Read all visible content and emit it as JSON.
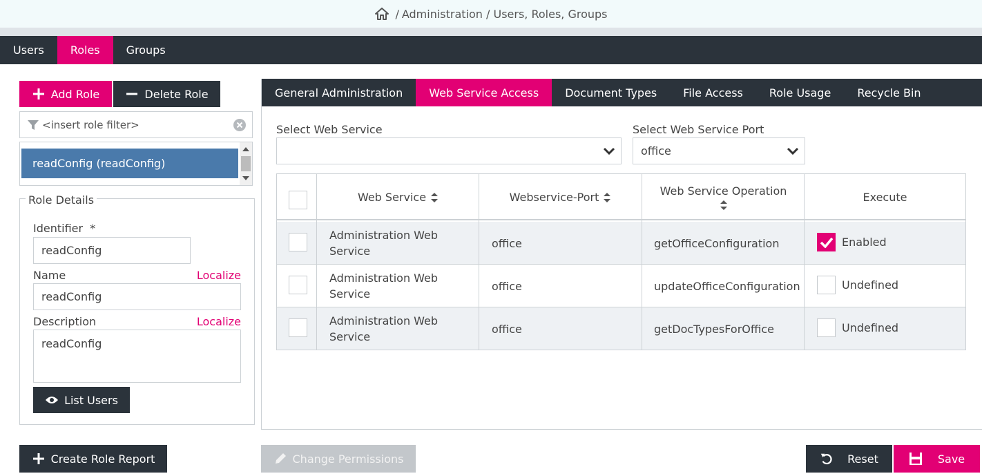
{
  "breadcrumb": {
    "path": "Administration / Users, Roles, Groups"
  },
  "main_tabs": [
    {
      "label": "Users"
    },
    {
      "label": "Roles"
    },
    {
      "label": "Groups"
    }
  ],
  "role_buttons": {
    "add": "Add Role",
    "delete": "Delete Role"
  },
  "role_filter": {
    "placeholder": "<insert role filter>"
  },
  "role_list": [
    {
      "label": "readConfig (readConfig)"
    }
  ],
  "role_details": {
    "legend": "Role Details",
    "identifier_label": "Identifier",
    "required_mark": "*",
    "identifier_value": "readConfig",
    "name_label": "Name",
    "name_value": "readConfig",
    "description_label": "Description",
    "description_value": "readConfig",
    "localize": "Localize",
    "list_users": "List Users"
  },
  "sub_tabs": [
    {
      "label": "General Administration"
    },
    {
      "label": "Web Service Access"
    },
    {
      "label": "Document Types"
    },
    {
      "label": "File Access"
    },
    {
      "label": "Role Usage"
    },
    {
      "label": "Recycle Bin"
    }
  ],
  "web_service": {
    "select_label": "Select Web Service",
    "select_value": "",
    "port_label": "Select Web Service Port",
    "port_value": "office"
  },
  "table": {
    "headers": {
      "service": "Web Service",
      "port": "Webservice-Port",
      "operation": "Web Service Operation",
      "execute": "Execute"
    },
    "rows": [
      {
        "service": "Administration Web Service",
        "port": "office",
        "operation": "getOfficeConfiguration",
        "execute": "Enabled",
        "checked": true
      },
      {
        "service": "Administration Web Service",
        "port": "office",
        "operation": "updateOfficeConfiguration",
        "execute": "Undefined",
        "checked": false
      },
      {
        "service": "Administration Web Service",
        "port": "office",
        "operation": "getDocTypesForOffice",
        "execute": "Undefined",
        "checked": false
      }
    ]
  },
  "footer": {
    "create_report": "Create Role Report",
    "change_permissions": "Change Permissions",
    "reset": "Reset",
    "save": "Save"
  },
  "colors": {
    "accent": "#e20074",
    "dark": "#2b333b",
    "selected_row": "#4a7aab"
  }
}
